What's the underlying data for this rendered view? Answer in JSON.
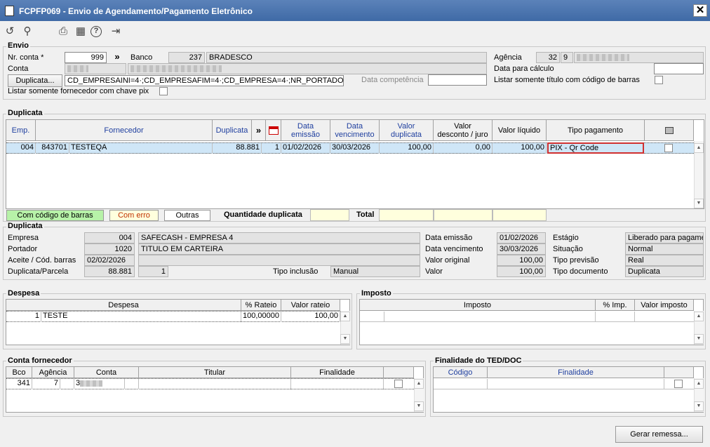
{
  "window": {
    "title": "FCPFP069 - Envio de Agendamento/Pagamento Eletrônico",
    "close": "✕"
  },
  "toolbar": {
    "undo": "↺",
    "search": "⚲",
    "print": "⎙",
    "calendar": "▦",
    "help": "?",
    "exit": "⇥"
  },
  "envio": {
    "title": "Envio",
    "nr_conta_label": "Nr. conta *",
    "nr_conta_value": "999",
    "nr_conta_btn": "»",
    "banco_label": "Banco",
    "banco_code": "237",
    "banco_name": "BRADESCO",
    "agencia_label": "Agência",
    "agencia_code": "32",
    "agencia_digit": "9",
    "conta_label": "Conta",
    "data_calculo_label": "Data para cálculo",
    "duplicata_btn": "Duplicata...",
    "filter_text": "CD_EMPRESAINI=4·;CD_EMPRESAFIM=4·;CD_EMPRESA=4·;NR_PORTADORINI=0·;",
    "data_competencia_label": "Data competência",
    "listar_codbarras_label": "Listar somente título com código de barras",
    "listar_pix_label": "Listar somente fornecedor com chave pix"
  },
  "duplicata_grid": {
    "title": "Duplicata",
    "headers": {
      "emp": "Emp.",
      "fornecedor": "Fornecedor",
      "duplicata": "Duplicata",
      "arrow": "»",
      "data_emissao": "Data\nemissão",
      "data_vencimento": "Data\nvencimento",
      "valor_duplicata": "Valor\nduplicata",
      "valor_desconto": "Valor\ndesconto / juro",
      "valor_liquido": "Valor líquido",
      "tipo_pagamento": "Tipo pagamento"
    },
    "rows": [
      {
        "emp": "004",
        "forn_code": "843701",
        "forn_name": "TESTEQA",
        "duplicata": "88.881",
        "parcela": "1",
        "data_emissao": "01/02/2026",
        "data_vencimento": "30/03/2026",
        "valor_duplicata": "100,00",
        "valor_desconto": "0,00",
        "valor_liquido": "100,00",
        "tipo_pagamento": "PIX - Qr Code"
      }
    ],
    "legend": {
      "com_codigo": "Com código de barras",
      "com_erro": "Com erro",
      "outras": "Outras"
    },
    "quantidade_label": "Quantidade duplicata",
    "total_label": "Total"
  },
  "duplicata_detail": {
    "title": "Duplicata",
    "empresa_label": "Empresa",
    "empresa_code": "004",
    "empresa_name": "SAFECASH -  EMPRESA 4",
    "portador_label": "Portador",
    "portador_code": "1020",
    "portador_name": "TITULO EM CARTEIRA",
    "aceite_label": "Aceite / Cód. barras",
    "aceite_value": "02/02/2026",
    "parcela_label": "Duplicata/Parcela",
    "duplicata_value": "88.881",
    "parcela_value": "1",
    "tipo_inclusao_label": "Tipo inclusão",
    "tipo_inclusao_value": "Manual",
    "data_emissao_label": "Data emissão",
    "data_emissao_value": "01/02/2026",
    "data_vencimento_label": "Data vencimento",
    "data_vencimento_value": "30/03/2026",
    "valor_original_label": "Valor original",
    "valor_original_value": "100,00",
    "valor_label": "Valor",
    "valor_value": "100,00",
    "estagio_label": "Estágio",
    "estagio_value": "Liberado para pagame",
    "situacao_label": "Situação",
    "situacao_value": "Normal",
    "tipo_previsao_label": "Tipo previsão",
    "tipo_previsao_value": "Real",
    "tipo_documento_label": "Tipo documento",
    "tipo_documento_value": "Duplicata"
  },
  "despesa": {
    "title": "Despesa",
    "headers": {
      "despesa": "Despesa",
      "rateio": "% Rateio",
      "valor": "Valor rateio"
    },
    "rows": [
      {
        "code": "1",
        "name": "TESTE",
        "rateio": "100,00000",
        "valor": "100,00"
      }
    ]
  },
  "imposto": {
    "title": "Imposto",
    "headers": {
      "imposto": "Imposto",
      "pct": "% Imp.",
      "valor": "Valor imposto"
    }
  },
  "conta_fornecedor": {
    "title": "Conta fornecedor",
    "headers": {
      "bco": "Bco",
      "agencia": "Agência",
      "conta": "Conta",
      "titular": "Titular",
      "finalidade": "Finalidade"
    },
    "rows": [
      {
        "bco": "341",
        "agencia": "7",
        "conta": "3"
      }
    ]
  },
  "finalidade": {
    "title": "Finalidade do TED/DOC",
    "headers": {
      "codigo": "Código",
      "finalidade": "Finalidade"
    }
  },
  "gerar_btn": "Gerar remessa...",
  "colors": {
    "title_bar": "#4a74ad",
    "header_blue": "#1f3f9f",
    "selected_row": "#cfe6f7",
    "highlight_border": "#d03030",
    "legend_green": "#b7f2a8",
    "legend_yellow": "#ffffdd"
  }
}
